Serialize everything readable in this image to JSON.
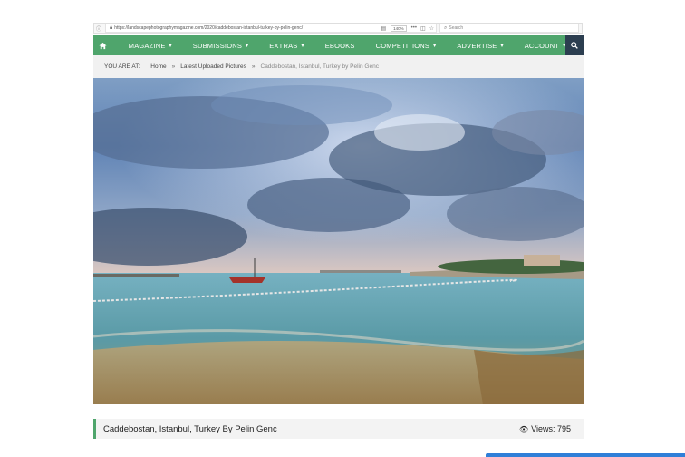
{
  "browser": {
    "url": "https://landscapephotographymagazine.com/2020/caddebostan-istanbul-turkey-by-pelin-genc/",
    "zoom": "140%",
    "search_placeholder": "Search"
  },
  "nav": {
    "items": [
      {
        "label": "MAGAZINE",
        "caret": true
      },
      {
        "label": "SUBMISSIONS",
        "caret": true
      },
      {
        "label": "EXTRAS",
        "caret": true
      },
      {
        "label": "EBOOKS",
        "caret": false
      },
      {
        "label": "COMPETITIONS",
        "caret": true
      },
      {
        "label": "ADVERTISE",
        "caret": true
      },
      {
        "label": "ACCOUNT",
        "caret": true
      }
    ],
    "accent": "#4fa56c",
    "search_bg": "#2c3e50"
  },
  "breadcrumb": {
    "prefix": "YOU ARE AT:",
    "home": "Home",
    "section": "Latest Uploaded Pictures",
    "current": "Caddebostan, Istanbul, Turkey by Pelin Genc"
  },
  "photo": {
    "title": "Caddebostan, Istanbul, Turkey By Pelin Genc",
    "views_label": "Views: 795"
  }
}
